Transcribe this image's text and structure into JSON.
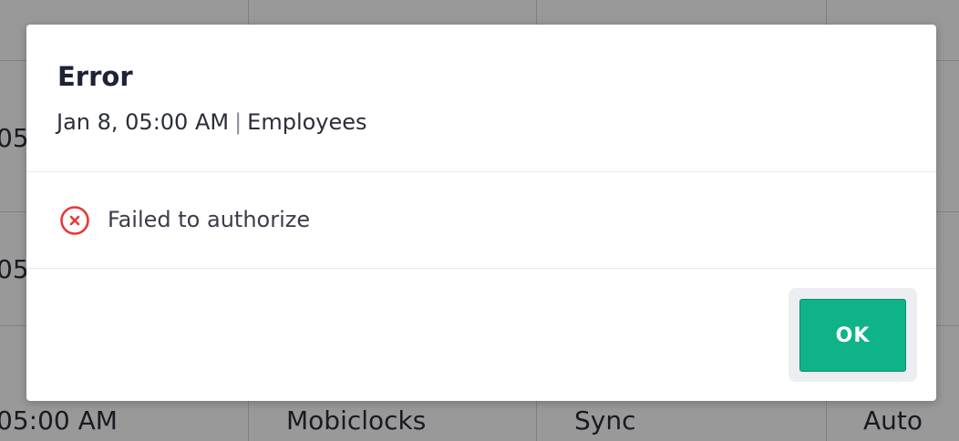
{
  "background_table": {
    "rows": [
      {
        "time": "05",
        "source": "",
        "action": "",
        "mode": ""
      },
      {
        "time": "05",
        "source": "",
        "action": "",
        "mode": ""
      },
      {
        "time": "05:00 AM",
        "source": "Mobiclocks",
        "action": "Sync",
        "mode": "Auto"
      }
    ]
  },
  "dialog": {
    "title": "Error",
    "date": "Jan 8, 05:00 AM",
    "separator": "|",
    "category": "Employees",
    "message": "Failed to authorize",
    "ok_label": "OK"
  },
  "colors": {
    "accent": "#0fb389",
    "error": "#e53935",
    "overlay": "rgba(0,0,0,0.40)"
  },
  "icons": {
    "error": "error-circle-x-icon"
  }
}
